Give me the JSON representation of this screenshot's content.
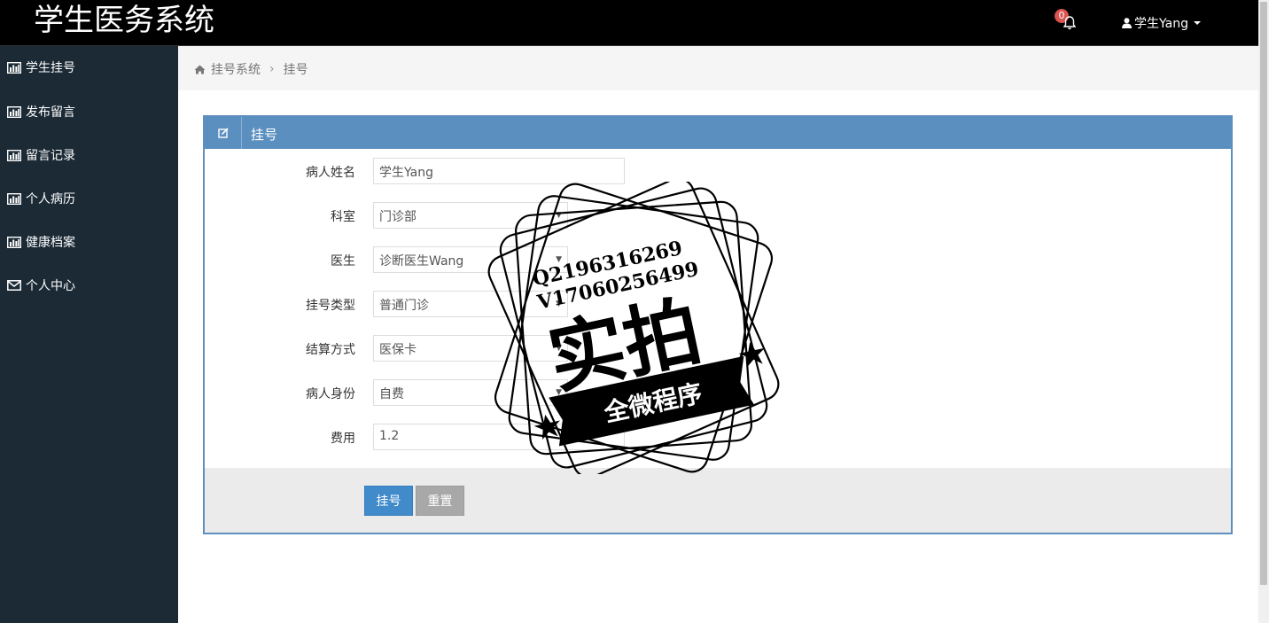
{
  "header": {
    "brand": "学生医务系统",
    "notification_count": "0",
    "user_label": "学生Yang"
  },
  "sidebar": {
    "items": [
      {
        "label": "学生挂号",
        "icon": "bar-chart-icon"
      },
      {
        "label": "发布留言",
        "icon": "bar-chart-icon"
      },
      {
        "label": "留言记录",
        "icon": "bar-chart-icon"
      },
      {
        "label": "个人病历",
        "icon": "bar-chart-icon"
      },
      {
        "label": "健康档案",
        "icon": "bar-chart-icon"
      },
      {
        "label": "个人中心",
        "icon": "envelope-icon"
      }
    ]
  },
  "breadcrumb": {
    "root": "挂号系统",
    "current": "挂号"
  },
  "panel": {
    "title": "挂号"
  },
  "form": {
    "patient_name": {
      "label": "病人姓名",
      "value": "学生Yang"
    },
    "department": {
      "label": "科室",
      "value": "门诊部"
    },
    "doctor": {
      "label": "医生",
      "value": "诊断医生Wang"
    },
    "registration_type": {
      "label": "挂号类型",
      "value": "普通门诊"
    },
    "payment_method": {
      "label": "结算方式",
      "value": "医保卡"
    },
    "patient_identity": {
      "label": "病人身份",
      "value": "自费"
    },
    "fee": {
      "label": "费用",
      "value": "1.2"
    }
  },
  "actions": {
    "submit": "挂号",
    "reset": "重置"
  },
  "watermark": {
    "line1": "Q2196316269",
    "line2": "V17060256499",
    "big": "实拍",
    "ribbon": "全微程序"
  },
  "colors": {
    "topbar": "#000000",
    "sidebar": "#1b2a35",
    "panel_header": "#5b8fc0",
    "primary_button": "#428bca",
    "reset_button": "#a8a8a8",
    "badge": "#d9534f"
  }
}
